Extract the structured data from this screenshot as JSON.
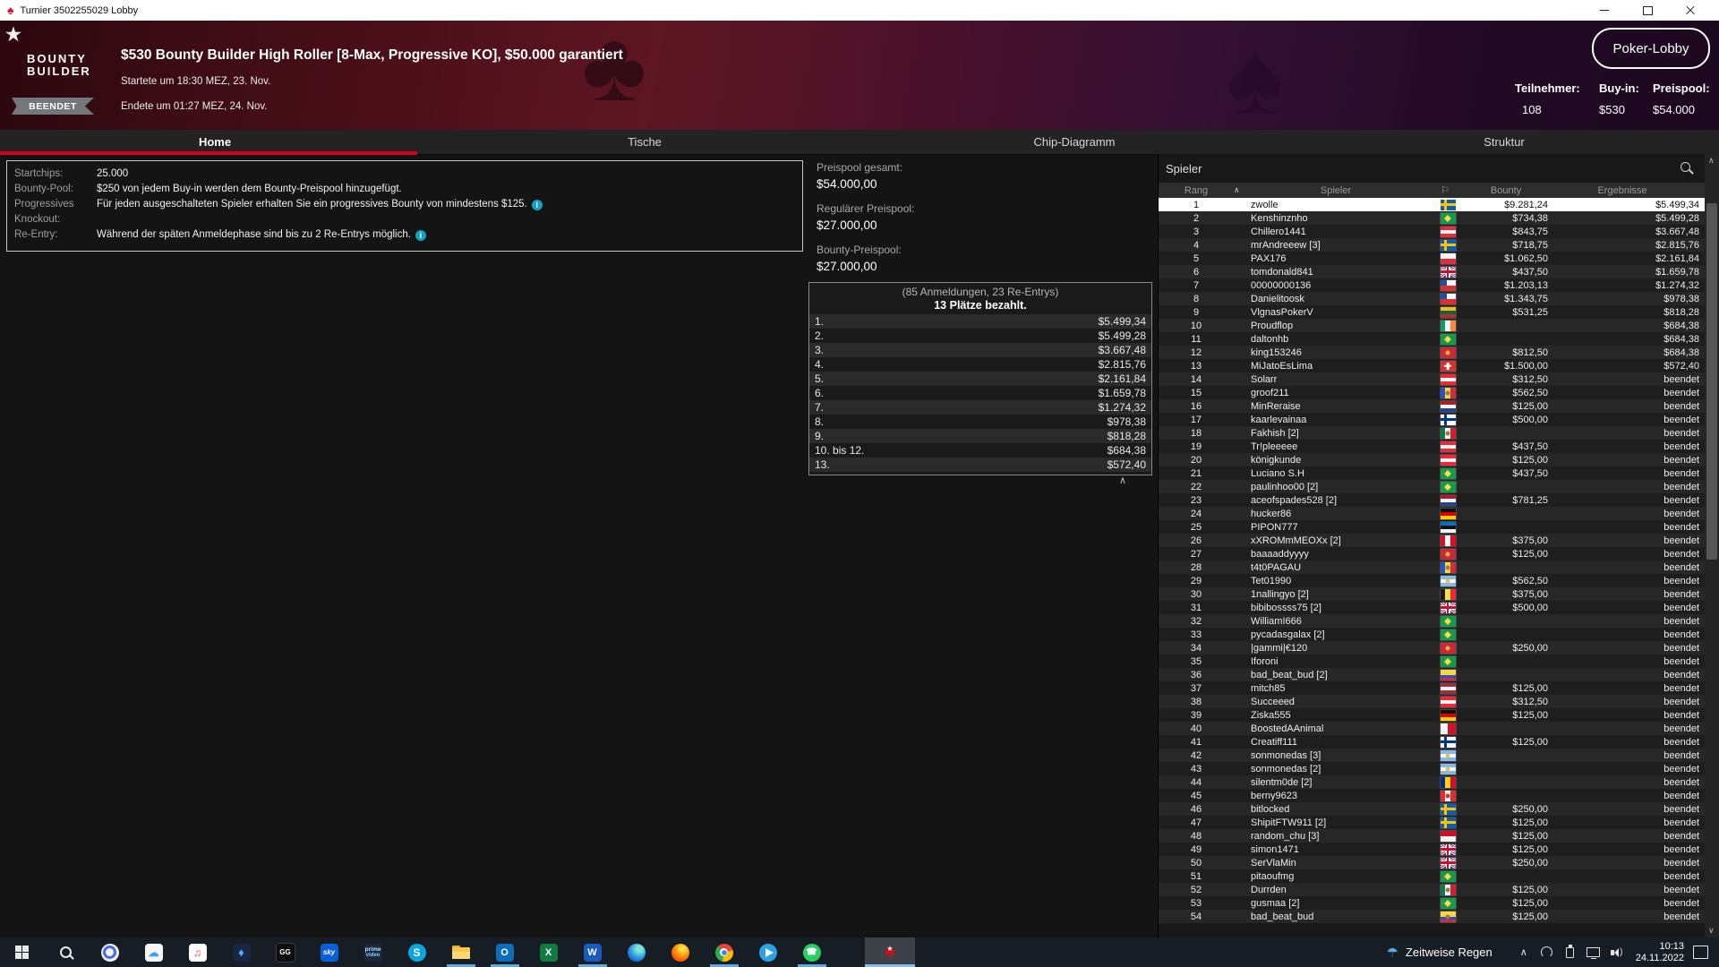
{
  "colors": {
    "accent_red": "#d70022",
    "info_teal": "#14a0c0",
    "selected_row": "#ffffff",
    "spade_red": "#e20613"
  },
  "icons": {
    "spade": "♠",
    "star": "★",
    "club": "♣",
    "flag": "⚐",
    "chevron_up": "∧",
    "chevron_down": "∨",
    "cloud": "☁",
    "music": "♫",
    "diamond": "♦",
    "phone": "☎",
    "info": "i",
    "umbrella": "☂"
  },
  "window": {
    "title": "Turnier 3502255029 Lobby"
  },
  "header": {
    "logo_line1": "BOUNTY",
    "logo_line2": "BUILDER",
    "title": "$530 Bounty Builder High Roller [8-Max, Progressive KO], $50.000 garantiert",
    "started": "Startete um 18:30 MEZ, 23. Nov.",
    "ended": "Endete um 01:27 MEZ, 24. Nov.",
    "status_badge": "BEENDET",
    "lobby_button": "Poker-Lobby",
    "stats": [
      {
        "label": "Teilnehmer:",
        "value": "108"
      },
      {
        "label": "Buy-in:",
        "value": "$530"
      },
      {
        "label": "Preispool:",
        "value": "$54.000"
      }
    ]
  },
  "tabs": [
    {
      "label": "Home",
      "active": true
    },
    {
      "label": "Tische",
      "active": false
    },
    {
      "label": "Chip-Diagramm",
      "active": false
    },
    {
      "label": "Struktur",
      "active": false
    }
  ],
  "info_box": {
    "rows": [
      {
        "label": "Startchips:",
        "value": "25.000",
        "info": false
      },
      {
        "label": "Bounty-Pool:",
        "value": "$250 von jedem Buy-in werden dem Bounty-Preispool hinzugefügt.",
        "info": false
      },
      {
        "label": "Progressives Knockout:",
        "value": "Für jeden ausgeschalteten Spieler erhalten Sie ein progressives Bounty von mindestens $125.",
        "info": true
      },
      {
        "label": "Re-Entry:",
        "value": "Während der späten Anmeldephase sind bis zu 2 Re-Entrys möglich.",
        "info": true
      }
    ]
  },
  "prizepool": {
    "items": [
      {
        "label": "Preispool gesamt:",
        "value": "$54.000,00"
      },
      {
        "label": "Regulärer Preispool:",
        "value": "$27.000,00"
      },
      {
        "label": "Bounty-Preispool:",
        "value": "$27.000,00"
      }
    ],
    "entries_note": "(85 Anmeldungen, 23 Re-Entrys)",
    "paid_note": "13 Plätze bezahlt.",
    "payouts": [
      [
        "1.",
        "$5.499,34"
      ],
      [
        "2.",
        "$5.499,28"
      ],
      [
        "3.",
        "$3.667,48"
      ],
      [
        "4.",
        "$2.815,76"
      ],
      [
        "5.",
        "$2.161,84"
      ],
      [
        "6.",
        "$1.659,78"
      ],
      [
        "7.",
        "$1.274,32"
      ],
      [
        "8.",
        "$978,38"
      ],
      [
        "9.",
        "$818,28"
      ],
      [
        "10. bis 12.",
        "$684,38"
      ],
      [
        "13.",
        "$572,40"
      ]
    ]
  },
  "flags": {
    "swe": {
      "t": "nordic",
      "bg": "#0a5eb5",
      "cross": "#ffc200"
    },
    "fin": {
      "t": "nordic",
      "bg": "#f5f5f5",
      "cross": "#003580"
    },
    "gbr": {
      "t": "uk"
    },
    "bra": {
      "t": "emb",
      "bg": "#159b4a",
      "emb": "#ffd84b",
      "eshape": "diamond"
    },
    "aut": {
      "t": "h",
      "s": [
        "#ed2939",
        "#f5f5f5",
        "#ed2939"
      ]
    },
    "pol": {
      "t": "h",
      "s": [
        "#f5f5f5",
        "#dc2f42"
      ]
    },
    "chl": {
      "t": "h",
      "s": [
        "#f5f5f5",
        "#d93038"
      ],
      "canton": "#1f4fa3"
    },
    "ltu": {
      "t": "h",
      "s": [
        "#fdb913",
        "#006a44",
        "#c1272d"
      ]
    },
    "irl": {
      "t": "v",
      "s": [
        "#169b62",
        "#f5f5f5",
        "#ff883e"
      ]
    },
    "mne": {
      "t": "emb",
      "bg": "#c92a38",
      "emb": "#e8b23a",
      "eshape": "dot"
    },
    "che": {
      "t": "emb",
      "bg": "#d93030",
      "emb": "#ffffff",
      "eshape": "cross"
    },
    "mda": {
      "t": "v",
      "s": [
        "#2a52be",
        "#f8d648",
        "#cc2c3b"
      ],
      "emb": "#9a7a4a",
      "eshape": "dot"
    },
    "nld": {
      "t": "h",
      "s": [
        "#ae1c28",
        "#f5f5f5",
        "#21468b"
      ]
    },
    "mex": {
      "t": "v",
      "s": [
        "#10784b",
        "#f5f5f5",
        "#cd2035"
      ],
      "emb": "#9a7a4a",
      "eshape": "dot"
    },
    "deu": {
      "t": "h",
      "s": [
        "#101010",
        "#dd0000",
        "#ffce00"
      ]
    },
    "est": {
      "t": "h",
      "s": [
        "#0072ce",
        "#101010",
        "#f5f5f5"
      ]
    },
    "per": {
      "t": "v",
      "s": [
        "#d91023",
        "#f5f5f5",
        "#d91023"
      ]
    },
    "arg": {
      "t": "h",
      "s": [
        "#85b8e8",
        "#f5f5f5",
        "#85b8e8"
      ],
      "emb": "#e8c04a",
      "eshape": "dot"
    },
    "bel": {
      "t": "v",
      "s": [
        "#1a1a1a",
        "#fae042",
        "#ed2939"
      ]
    },
    "col": {
      "t": "h",
      "s": [
        "#f8d648",
        "#2a52be",
        "#cc2c3b"
      ],
      "w": [
        2,
        1,
        1
      ]
    },
    "ecu": {
      "t": "h",
      "s": [
        "#f8d648",
        "#2a52be",
        "#cc2c3b"
      ],
      "w": [
        2,
        1,
        1
      ],
      "emb": "#9a7a4a",
      "eshape": "dot"
    },
    "lva": {
      "t": "h",
      "s": [
        "#9e3039",
        "#f5f5f5",
        "#9e3039"
      ]
    },
    "mlt": {
      "t": "v",
      "s": [
        "#f5f5f5",
        "#cf142b"
      ]
    },
    "rou": {
      "t": "v",
      "s": [
        "#002b7f",
        "#fcd116",
        "#ce1126"
      ]
    },
    "can": {
      "t": "v",
      "s": [
        "#d93030",
        "#f5f5f5",
        "#d93030"
      ],
      "emb": "#d93030",
      "eshape": "dot"
    },
    "idn": {
      "t": "h",
      "s": [
        "#ce1126",
        "#f5f5f5"
      ]
    }
  },
  "players_panel": {
    "title": "Spieler",
    "selected_rank": 1,
    "columns": {
      "rank": "Rang",
      "player": "Spieler",
      "bounty": "Bounty",
      "result": "Ergebnisse"
    },
    "rows": [
      [
        1,
        "zwolle",
        "swe",
        "$9.281,24",
        "$5.499,34"
      ],
      [
        2,
        "Kenshinznho",
        "bra",
        "$734,38",
        "$5.499,28"
      ],
      [
        3,
        "Chillero1441",
        "aut",
        "$843,75",
        "$3.667,48"
      ],
      [
        4,
        "mrAndreeew [3]",
        "swe",
        "$718,75",
        "$2.815,76"
      ],
      [
        5,
        "PAX176",
        "pol",
        "$1.062,50",
        "$2.161,84"
      ],
      [
        6,
        "tomdonald841",
        "gbr",
        "$437,50",
        "$1.659,78"
      ],
      [
        7,
        "00000000136",
        "chl",
        "$1.203,13",
        "$1.274,32"
      ],
      [
        8,
        "Danielitoosk",
        "chl",
        "$1.343,75",
        "$978,38"
      ],
      [
        9,
        "VlgnasPokerV",
        "ltu",
        "$531,25",
        "$818,28"
      ],
      [
        10,
        "Proudflop",
        "irl",
        "",
        "$684,38"
      ],
      [
        11,
        "daltonhb",
        "bra",
        "",
        "$684,38"
      ],
      [
        12,
        "king153246",
        "mne",
        "$812,50",
        "$684,38"
      ],
      [
        13,
        "MiJatoEsLima",
        "che",
        "$1.500,00",
        "$572,40"
      ],
      [
        14,
        "Solarr",
        "aut",
        "$312,50",
        "beendet"
      ],
      [
        15,
        "groof211",
        "mda",
        "$562,50",
        "beendet"
      ],
      [
        16,
        "MinReraise",
        "nld",
        "$125,00",
        "beendet"
      ],
      [
        17,
        "kaarlevainaa",
        "fin",
        "$500,00",
        "beendet"
      ],
      [
        18,
        "Fakhish [2]",
        "mex",
        "",
        "beendet"
      ],
      [
        19,
        "Tr!pleeeee",
        "aut",
        "$437,50",
        "beendet"
      ],
      [
        20,
        "königkunde",
        "aut",
        "$125,00",
        "beendet"
      ],
      [
        21,
        "Luciano S.H",
        "bra",
        "$437,50",
        "beendet"
      ],
      [
        22,
        "paulinhoo00 [2]",
        "bra",
        "",
        "beendet"
      ],
      [
        23,
        "aceofspades528 [2]",
        "nld",
        "$781,25",
        "beendet"
      ],
      [
        24,
        "hucker86",
        "deu",
        "",
        "beendet"
      ],
      [
        25,
        "PIPON777",
        "est",
        "",
        "beendet"
      ],
      [
        26,
        "xXROMmMEOXx [2]",
        "per",
        "$375,00",
        "beendet"
      ],
      [
        27,
        "baaaaddyyyy",
        "mne",
        "$125,00",
        "beendet"
      ],
      [
        28,
        "t4t0PAGAU",
        "mda",
        "",
        "beendet"
      ],
      [
        29,
        "Tet01990",
        "arg",
        "$562,50",
        "beendet"
      ],
      [
        30,
        "1nallingyo [2]",
        "bel",
        "$375,00",
        "beendet"
      ],
      [
        31,
        "bibibossss75 [2]",
        "gbr",
        "$500,00",
        "beendet"
      ],
      [
        32,
        "WilliamI666",
        "bra",
        "",
        "beendet"
      ],
      [
        33,
        "pycadasgalax [2]",
        "bra",
        "",
        "beendet"
      ],
      [
        34,
        "|gammi|€120",
        "mne",
        "$250,00",
        "beendet"
      ],
      [
        35,
        "Iforoni",
        "bra",
        "",
        "beendet"
      ],
      [
        36,
        "bad_beat_bud [2]",
        "col",
        "",
        "beendet"
      ],
      [
        37,
        "mitch85",
        "lva",
        "$125,00",
        "beendet"
      ],
      [
        38,
        "Succeeed",
        "aut",
        "$312,50",
        "beendet"
      ],
      [
        39,
        "Ziska555",
        "deu",
        "$125,00",
        "beendet"
      ],
      [
        40,
        "BoostedAAnimal",
        "mlt",
        "",
        "beendet"
      ],
      [
        41,
        "Creatiff111",
        "fin",
        "$125,00",
        "beendet"
      ],
      [
        42,
        "sonmonedas [3]",
        "arg",
        "",
        "beendet"
      ],
      [
        43,
        "sonmonedas [2]",
        "arg",
        "",
        "beendet"
      ],
      [
        44,
        "silentm0de [2]",
        "rou",
        "",
        "beendet"
      ],
      [
        45,
        "berny9623",
        "can",
        "",
        "beendet"
      ],
      [
        46,
        "bitlocked",
        "swe",
        "$250,00",
        "beendet"
      ],
      [
        47,
        "ShipitFTW911 [2]",
        "swe",
        "$125,00",
        "beendet"
      ],
      [
        48,
        "random_chu [3]",
        "idn",
        "$125,00",
        "beendet"
      ],
      [
        49,
        "simon1471",
        "gbr",
        "$125,00",
        "beendet"
      ],
      [
        50,
        "SerVlaMin",
        "gbr",
        "$250,00",
        "beendet"
      ],
      [
        51,
        "pitaoufmg",
        "bra",
        "",
        "beendet"
      ],
      [
        52,
        "Durrden",
        "mex",
        "$125,00",
        "beendet"
      ],
      [
        53,
        "gusmaa [2]",
        "bra",
        "$125,00",
        "beendet"
      ],
      [
        54,
        "bad_beat_bud",
        "ecu",
        "$125,00",
        "beendet"
      ]
    ]
  },
  "taskbar": {
    "icons": [
      {
        "name": "start",
        "active": false
      },
      {
        "name": "search",
        "active": false
      },
      {
        "name": "round-app",
        "active": false
      },
      {
        "name": "icloud",
        "active": false
      },
      {
        "name": "apple-music",
        "active": false
      },
      {
        "name": "diamond-app",
        "active": false
      },
      {
        "name": "ggpoker",
        "text": "GG",
        "active": false
      },
      {
        "name": "sky-go",
        "text": "sky",
        "active": false
      },
      {
        "name": "prime-video",
        "text1": "prime",
        "text2": "video",
        "active": false
      },
      {
        "name": "skype",
        "text": "S",
        "active": false
      },
      {
        "name": "file-explorer",
        "active": true
      },
      {
        "name": "outlook",
        "text": "O",
        "active": true
      },
      {
        "name": "excel",
        "text": "X",
        "active": false
      },
      {
        "name": "word",
        "text": "W",
        "active": true
      },
      {
        "name": "edge",
        "active": false
      },
      {
        "name": "firefox",
        "active": false
      },
      {
        "name": "chrome",
        "active": true
      },
      {
        "name": "telegram",
        "active": false
      },
      {
        "name": "whatsapp",
        "active": true
      },
      {
        "name": "pokerstars",
        "active": true,
        "focused": true
      }
    ],
    "tray": {
      "weather": "Zeitweise Regen",
      "time": "10:13",
      "date": "24.11.2022"
    }
  }
}
